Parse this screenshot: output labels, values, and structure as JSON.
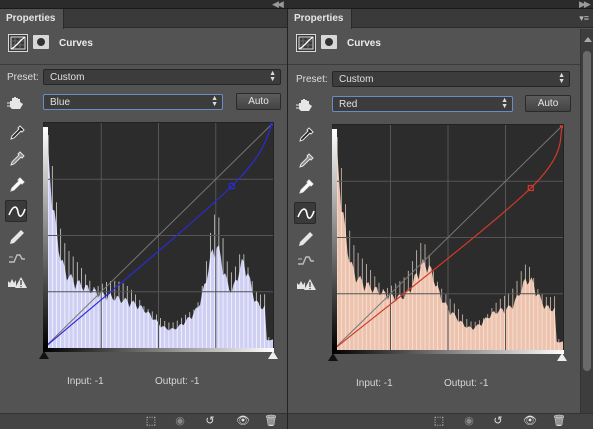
{
  "panels": [
    {
      "tab_label": "Properties",
      "header_title": "Curves",
      "preset_label": "Preset:",
      "preset_value": "Custom",
      "channel_value": "Blue",
      "auto_label": "Auto",
      "input_text": "Input:  -1",
      "output_text": "Output:  -1",
      "curve_color": "#2b2bd6",
      "histogram_fill": "#d8d8ff",
      "histogram_line": "#ffffff"
    },
    {
      "tab_label": "Properties",
      "header_title": "Curves",
      "preset_label": "Preset:",
      "preset_value": "Custom",
      "channel_value": "Red",
      "auto_label": "Auto",
      "input_text": "Input:  -1",
      "output_text": "Output:  -1",
      "curve_color": "#d23a2a",
      "histogram_fill": "#f6cbb6",
      "histogram_line": "#ffe9dd"
    }
  ],
  "icons": {
    "tools": [
      "target-adjust-icon",
      "black-eyedropper-icon",
      "gray-eyedropper-icon",
      "white-eyedropper-icon",
      "curve-edit-icon",
      "pencil-icon",
      "smooth-icon",
      "clipping-warning-icon"
    ],
    "bottom": [
      "clip-to-layer-icon",
      "view-previous-icon",
      "reset-icon",
      "visibility-eye-icon",
      "delete-icon"
    ]
  }
}
